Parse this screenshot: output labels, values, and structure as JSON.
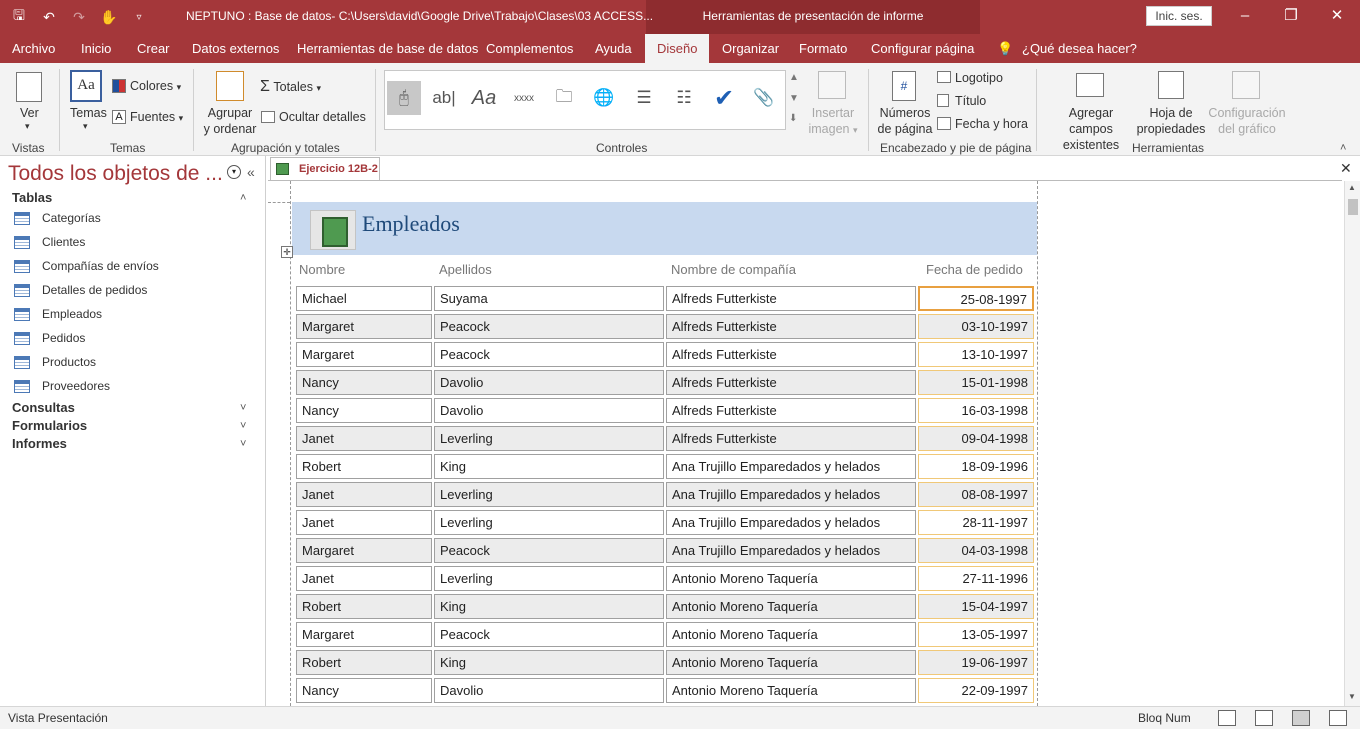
{
  "titlebar": {
    "doc_title": "NEPTUNO : Base de datos- C:\\Users\\david\\Google Drive\\Trabajo\\Clases\\03 ACCESS...",
    "context_title": "Herramientas de presentación de informe",
    "signin": "Inic. ses."
  },
  "tabs": [
    "Archivo",
    "Inicio",
    "Crear",
    "Datos externos",
    "Herramientas de base de datos",
    "Complementos",
    "Ayuda",
    "Diseño",
    "Organizar",
    "Formato",
    "Configurar página"
  ],
  "tell_me": "¿Qué desea hacer?",
  "ribbon": {
    "vistas": {
      "ver": "Ver",
      "group": "Vistas"
    },
    "temas": {
      "temas": "Temas",
      "colores": "Colores",
      "fuentes": "Fuentes",
      "group": "Temas"
    },
    "agrupacion": {
      "agrupar1": "Agrupar",
      "agrupar2": "y ordenar",
      "totales": "Totales",
      "ocultar": "Ocultar detalles",
      "group": "Agrupación y totales"
    },
    "controles": {
      "insertar1": "Insertar",
      "insertar2": "imagen",
      "group": "Controles"
    },
    "encabezado": {
      "numeros1": "Números",
      "numeros2": "de página",
      "logotipo": "Logotipo",
      "titulo": "Título",
      "fecha": "Fecha y hora",
      "group": "Encabezado y pie de página"
    },
    "herramientas": {
      "agregar1": "Agregar campos",
      "agregar2": "existentes",
      "hoja1": "Hoja de",
      "hoja2": "propiedades",
      "config1": "Configuración",
      "config2": "del gráfico",
      "group": "Herramientas"
    }
  },
  "nav": {
    "title": "Todos los objetos de ...",
    "tablas": "Tablas",
    "items": [
      "Categorías",
      "Clientes",
      "Compañías de envíos",
      "Detalles de pedidos",
      "Empleados",
      "Pedidos",
      "Productos",
      "Proveedores"
    ],
    "consultas": "Consultas",
    "formularios": "Formularios",
    "informes": "Informes"
  },
  "doc_tab": "Ejercicio 12B-2",
  "report": {
    "title": "Empleados",
    "columns": [
      "Nombre",
      "Apellidos",
      "Nombre de compañía",
      "Fecha de pedido"
    ],
    "rows": [
      [
        "Michael",
        "Suyama",
        "Alfreds Futterkiste",
        "25-08-1997"
      ],
      [
        "Margaret",
        "Peacock",
        "Alfreds Futterkiste",
        "03-10-1997"
      ],
      [
        "Margaret",
        "Peacock",
        "Alfreds Futterkiste",
        "13-10-1997"
      ],
      [
        "Nancy",
        "Davolio",
        "Alfreds Futterkiste",
        "15-01-1998"
      ],
      [
        "Nancy",
        "Davolio",
        "Alfreds Futterkiste",
        "16-03-1998"
      ],
      [
        "Janet",
        "Leverling",
        "Alfreds Futterkiste",
        "09-04-1998"
      ],
      [
        "Robert",
        "King",
        "Ana Trujillo Emparedados y helados",
        "18-09-1996"
      ],
      [
        "Janet",
        "Leverling",
        "Ana Trujillo Emparedados y helados",
        "08-08-1997"
      ],
      [
        "Janet",
        "Leverling",
        "Ana Trujillo Emparedados y helados",
        "28-11-1997"
      ],
      [
        "Margaret",
        "Peacock",
        "Ana Trujillo Emparedados y helados",
        "04-03-1998"
      ],
      [
        "Janet",
        "Leverling",
        "Antonio Moreno Taquería",
        "27-11-1996"
      ],
      [
        "Robert",
        "King",
        "Antonio Moreno Taquería",
        "15-04-1997"
      ],
      [
        "Margaret",
        "Peacock",
        "Antonio Moreno Taquería",
        "13-05-1997"
      ],
      [
        "Robert",
        "King",
        "Antonio Moreno Taquería",
        "19-06-1997"
      ],
      [
        "Nancy",
        "Davolio",
        "Antonio Moreno Taquería",
        "22-09-1997"
      ]
    ]
  },
  "status": {
    "left": "Vista Presentación",
    "num": "Bloq Num"
  },
  "colors": {
    "accent": "#a4373a",
    "header_band": "#c8d9ef",
    "selection": "#e8a040"
  }
}
